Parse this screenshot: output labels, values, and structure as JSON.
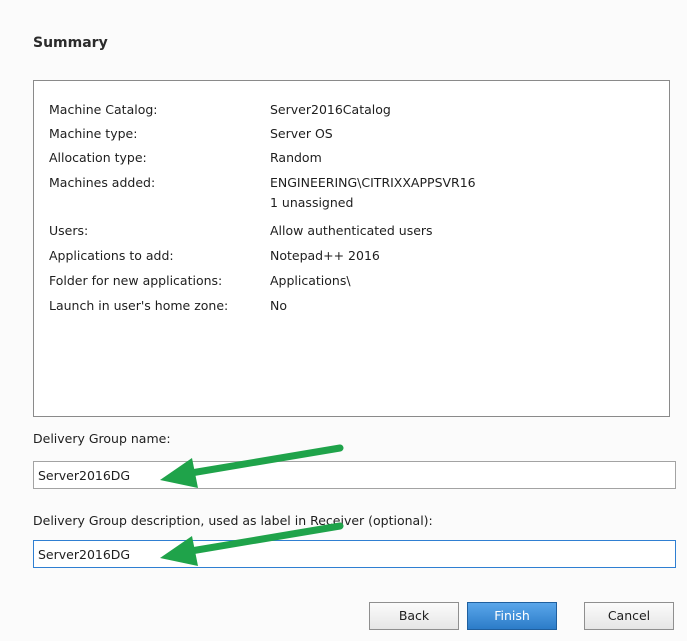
{
  "title": "Summary",
  "summary": [
    {
      "key": "Machine Catalog:",
      "value": "Server2016Catalog"
    },
    {
      "key": "Machine type:",
      "value": "Server OS"
    },
    {
      "key": "Allocation type:",
      "value": "Random"
    },
    {
      "key": "Machines added:",
      "value": "ENGINEERING\\CITRIXXAPPSVR16",
      "value2": "1 unassigned"
    },
    {
      "key": "Users:",
      "value": "Allow authenticated users"
    },
    {
      "key": "Applications to add:",
      "value": "Notepad++ 2016"
    },
    {
      "key": "Folder for new applications:",
      "value": "Applications\\"
    },
    {
      "key": "Launch in user's home zone:",
      "value": "No"
    }
  ],
  "delivery_group_name": {
    "label": "Delivery Group name:",
    "value": "Server2016DG"
  },
  "delivery_group_description": {
    "label": "Delivery Group description, used as label in Receiver (optional):",
    "value": "Server2016DG"
  },
  "buttons": {
    "back": "Back",
    "finish": "Finish",
    "cancel": "Cancel"
  },
  "colors": {
    "annotation_arrow": "#1fa34a",
    "primary_button": "#3b8fdc",
    "focus_border": "#2f7fd2"
  },
  "icons": {
    "annotation": "arrow-left-icon"
  }
}
